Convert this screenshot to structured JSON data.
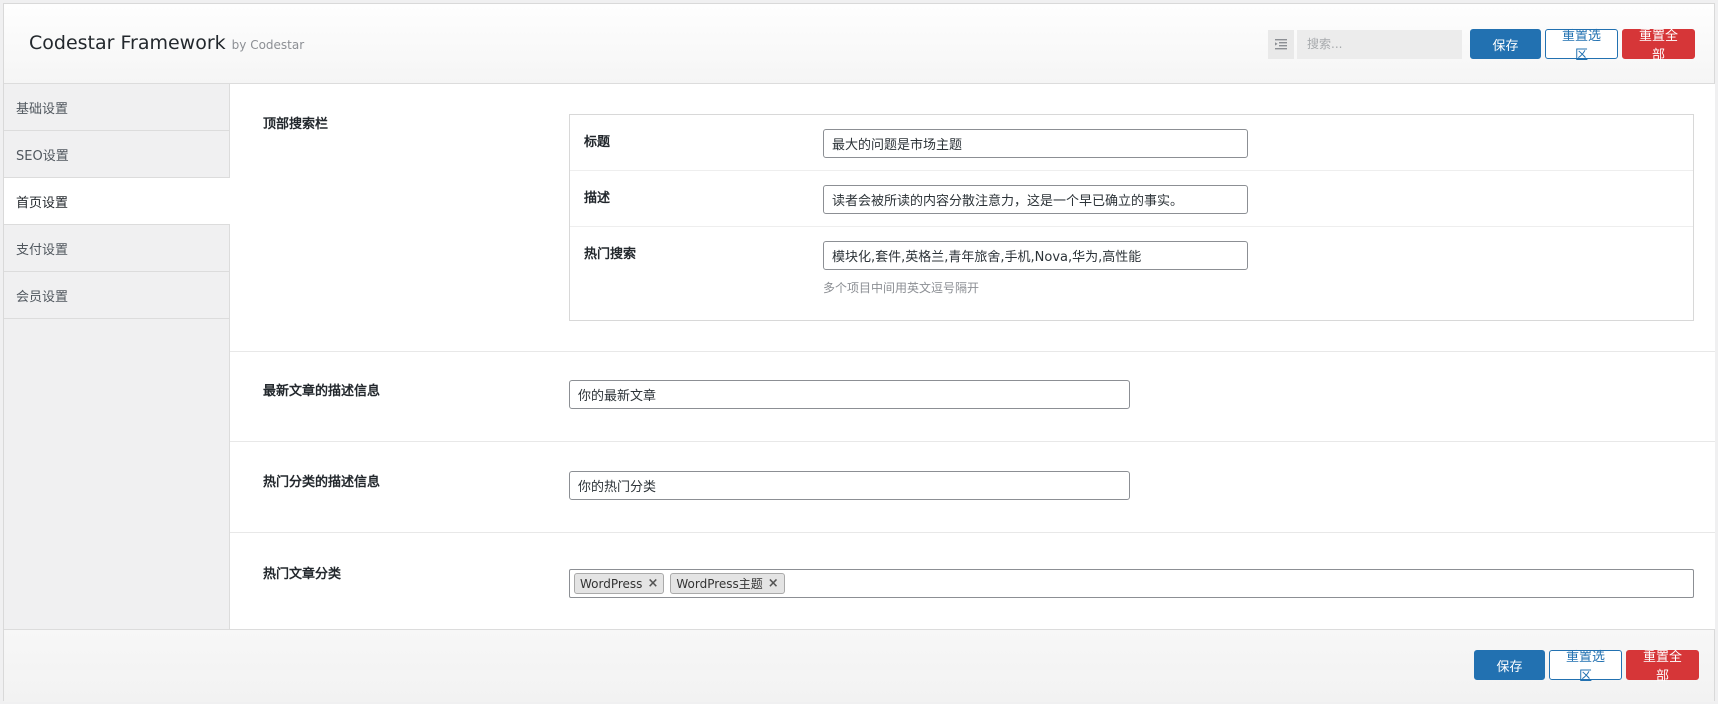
{
  "header": {
    "title": "Codestar Framework",
    "by": "by Codestar",
    "search_placeholder": "搜索...",
    "save_label": "保存",
    "reset_section_label": "重置选区",
    "reset_all_label": "重置全部"
  },
  "sidebar": {
    "items": [
      {
        "label": "基础设置",
        "active": false
      },
      {
        "label": "SEO设置",
        "active": false
      },
      {
        "label": "首页设置",
        "active": true
      },
      {
        "label": "支付设置",
        "active": false
      },
      {
        "label": "会员设置",
        "active": false
      }
    ]
  },
  "content": {
    "top_search": {
      "label": "顶部搜索栏",
      "fields": [
        {
          "label": "标题",
          "value": "最大的问题是市场主题"
        },
        {
          "label": "描述",
          "value": "读者会被所读的内容分散注意力，这是一个早已确立的事实。"
        },
        {
          "label": "热门搜索",
          "value": "模块化,套件,英格兰,青年旅舍,手机,Nova,华为,高性能",
          "hint": "多个项目中间用英文逗号隔开"
        }
      ]
    },
    "latest_desc": {
      "label": "最新文章的描述信息",
      "value": "你的最新文章"
    },
    "hot_category_desc": {
      "label": "热门分类的描述信息",
      "value": "你的热门分类"
    },
    "hot_categories": {
      "label": "热门文章分类",
      "tags": [
        "WordPress",
        "WordPress主题"
      ]
    }
  },
  "footer": {
    "save_label": "保存",
    "reset_section_label": "重置选区",
    "reset_all_label": "重置全部"
  },
  "icons": {
    "expand": "expand-all-icon",
    "tag_remove": "×"
  },
  "colors": {
    "primary": "#2271b1",
    "danger": "#d63638",
    "sidebar_bg": "#f0f0f1"
  }
}
